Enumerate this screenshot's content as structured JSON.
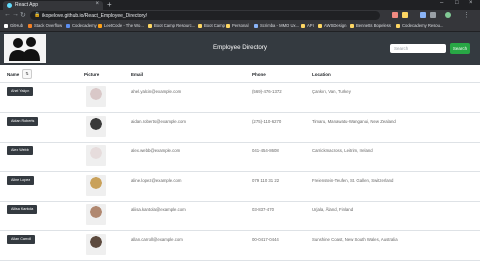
{
  "browser": {
    "tab_title": "React App",
    "url": "ikopelove.github.io/React_Employee_Directory/",
    "bookmarks": [
      "GitHub",
      "Stack Overflow",
      "Codecademy",
      "LeetCode - The Wo...",
      "Boot Camp Resourc...",
      "Boot Camp",
      "Personal",
      "Scrimba - MMO Ux...",
      "API",
      "AWSDesign",
      "Bennetts Bopeless",
      "Codecademy Resou..."
    ]
  },
  "header": {
    "title": "Employee Directory",
    "search_placeholder": "Search",
    "search_button": "Search"
  },
  "table": {
    "columns": {
      "name": "Name",
      "sort": "⇅",
      "picture": "Picture",
      "email": "Email",
      "phone": "Phone",
      "location": "Location"
    },
    "rows": [
      {
        "name": "Ahel Yalçın",
        "email": "ahel.yalcin@example.com",
        "phone": "(569)-476-1372",
        "location": "Çankırı, Van, Turkey",
        "photo": "#d9c8c8"
      },
      {
        "name": "Aidan Roberts",
        "email": "aidan.roberts@example.com",
        "phone": "(275)-110-6270",
        "location": "Timaru, Manawatu-Wanganui, New Zealand",
        "photo": "#3a3a3a"
      },
      {
        "name": "Alex Webb",
        "email": "alex.webb@example.com",
        "phone": "041-454-8608",
        "location": "Carrickmacross, Leitrim, Ireland",
        "photo": "#e6dcdc"
      },
      {
        "name": "Aline Lopez",
        "email": "aline.lopez@example.com",
        "phone": "079 110 31 22",
        "location": "Freienstein-Teufen, St. Gallen, Switzerland",
        "photo": "#c9a15a"
      },
      {
        "name": "Aliisa Kantola",
        "email": "aliisa.kantola@example.com",
        "phone": "03-837-470",
        "location": "Urjala, Åland, Finland",
        "photo": "#b08870"
      },
      {
        "name": "Allan Carroll",
        "email": "allan.carroll@example.com",
        "phone": "00-0417-0444",
        "location": "Sunshine Coast, New South Wales, Australia",
        "photo": "#5c4a3e"
      }
    ]
  }
}
